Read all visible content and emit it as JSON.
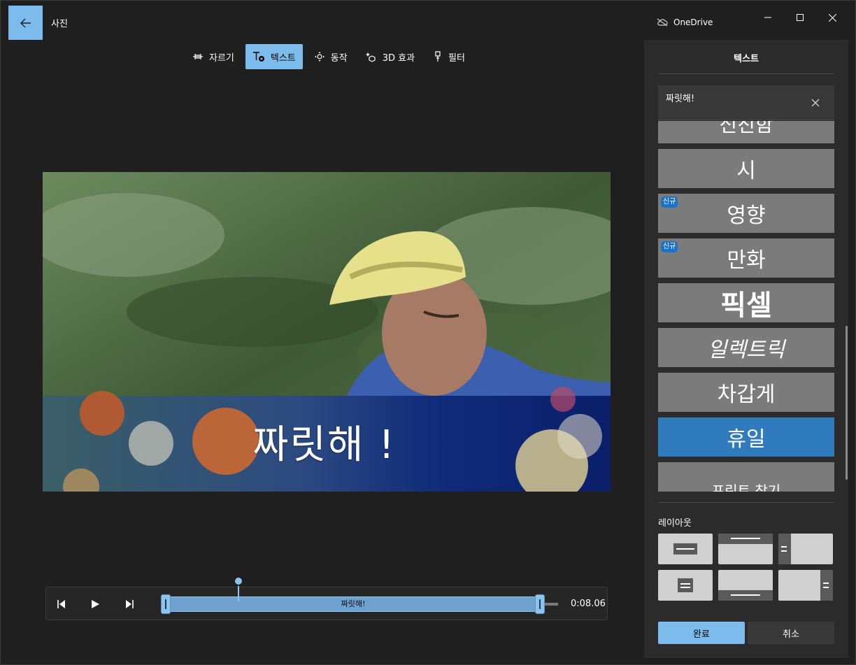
{
  "app": {
    "title": "사진",
    "cloud_label": "OneDrive"
  },
  "toolbar": {
    "items": [
      {
        "label": "자르기",
        "icon": "trim-icon",
        "active": false
      },
      {
        "label": "텍스트",
        "icon": "text-add-icon",
        "active": true
      },
      {
        "label": "동작",
        "icon": "motion-icon",
        "active": false
      },
      {
        "label": "3D 효과",
        "icon": "3d-effects-icon",
        "active": false
      },
      {
        "label": "필터",
        "icon": "filter-icon",
        "active": false
      }
    ]
  },
  "canvas": {
    "caption": "짜릿해 !"
  },
  "timeline": {
    "clip_label": "짜릿해!",
    "time": "0:08.06"
  },
  "panel": {
    "title": "텍스트",
    "text_value": "짜릿해!",
    "styles": [
      {
        "label": "신진함",
        "badge": ""
      },
      {
        "label": "시",
        "badge": ""
      },
      {
        "label": "영향",
        "badge": "신규"
      },
      {
        "label": "만화",
        "badge": "신규"
      },
      {
        "label": "픽셀",
        "badge": ""
      },
      {
        "label": "일렉트릭",
        "badge": ""
      },
      {
        "label": "차갑게",
        "badge": ""
      },
      {
        "label": "휴일",
        "badge": "",
        "selected": true
      },
      {
        "label": "프린트 찾기",
        "badge": ""
      }
    ],
    "layout_label": "레이아웃",
    "done_label": "완료",
    "cancel_label": "취소"
  },
  "colors": {
    "accent": "#7cbcec",
    "selected_style": "#2f7bbd",
    "panel_bg": "#2b2b2b",
    "window_bg": "#1f1f1f"
  }
}
